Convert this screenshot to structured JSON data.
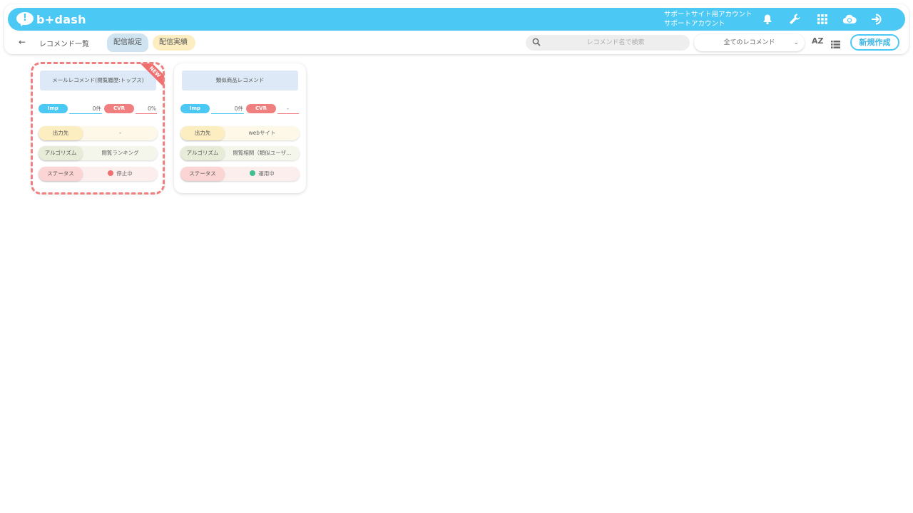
{
  "brand": {
    "name": "b+dash"
  },
  "header": {
    "account_line1": "サポートサイト用アカウント",
    "account_line2": "サポートアカウント",
    "icons": [
      "bell-icon",
      "wrench-icon",
      "grid-icon",
      "cloud-sync-icon",
      "logout-icon"
    ]
  },
  "subbar": {
    "back_glyph": "←",
    "breadcrumb": "レコメンド一覧",
    "tabs": [
      {
        "label": "配信設定",
        "active": true
      },
      {
        "label": "配信実績",
        "active": false
      }
    ],
    "search_placeholder": "レコメンド名で検索",
    "filter_selected": "全てのレコメンド",
    "sort_label": "AZ",
    "new_button": "新規作成"
  },
  "cards": [
    {
      "title": "メールレコメンド(閲覧履歴:トップス)",
      "badge": "NEW",
      "imp_label": "Imp",
      "imp_value": "0件",
      "cvr_label": "CVR",
      "cvr_value": "0%",
      "output_label": "出力先",
      "output_value": "-",
      "algorithm_label": "アルゴリズム",
      "algorithm_value": "閲覧ランキング",
      "status_label": "ステータス",
      "status_value": "停止中"
    },
    {
      "title": "類似商品レコメンド",
      "imp_label": "Imp",
      "imp_value": "0件",
      "cvr_label": "CVR",
      "cvr_value": "-",
      "output_label": "出力先",
      "output_value": "webサイト",
      "algorithm_label": "アルゴリズム",
      "algorithm_value": "閲覧相関（類似ユーザ…",
      "status_label": "ステータス",
      "status_value": "運用中"
    }
  ],
  "colors": {
    "primary": "#4cc8f5",
    "cvr": "#f07f7f",
    "stopped": "#f07070",
    "running": "#3fbf8f"
  }
}
